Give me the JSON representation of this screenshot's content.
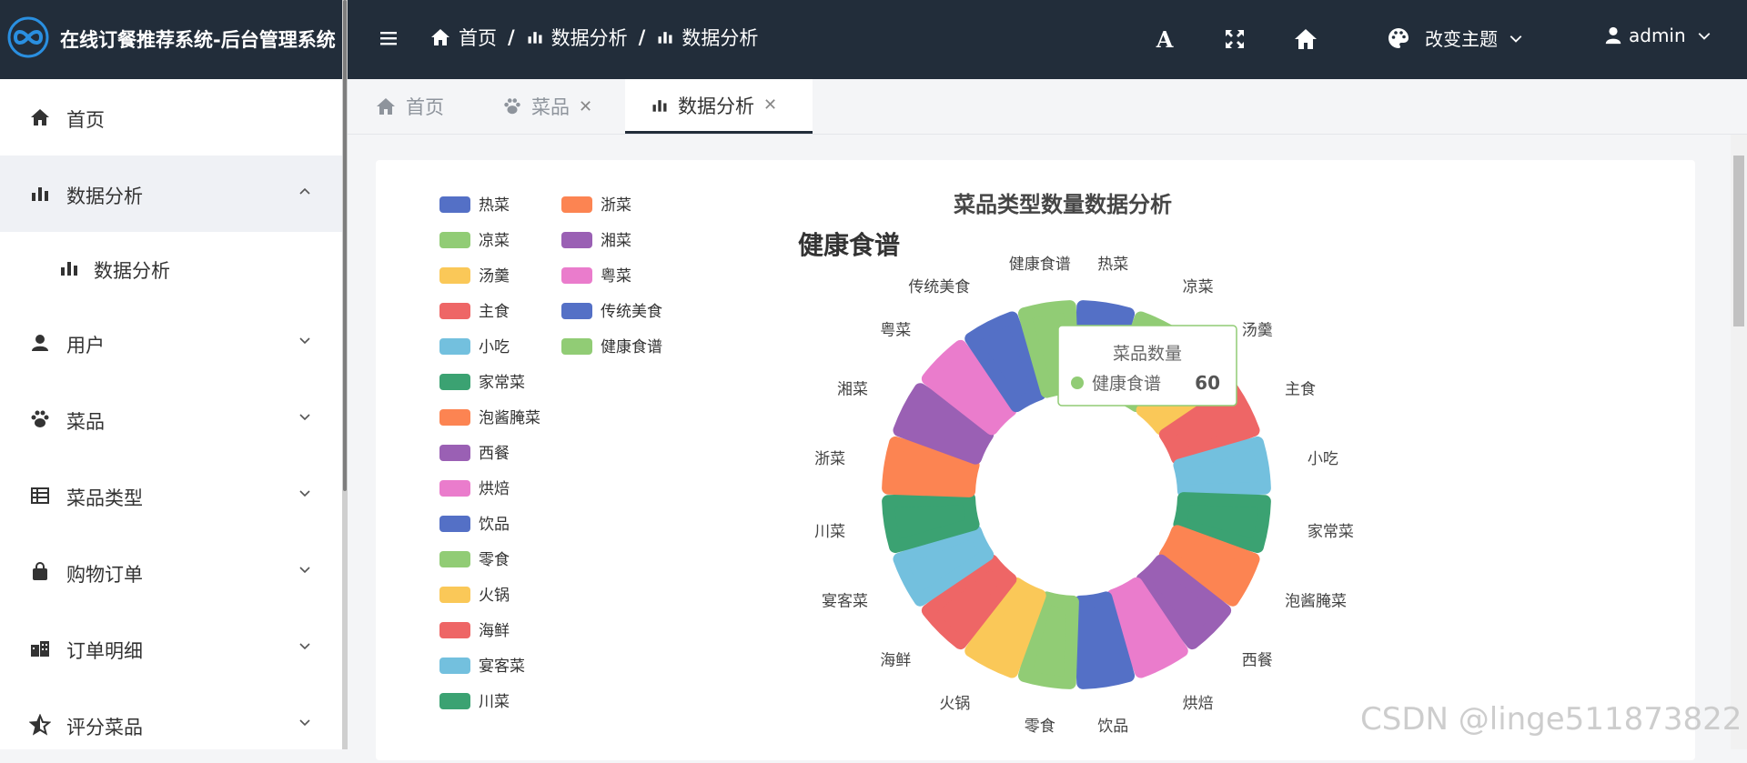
{
  "app": {
    "title": "在线订餐推荐系统-后台管理系统"
  },
  "sidebar": {
    "items": [
      {
        "label": "首页",
        "icon": "home-icon"
      },
      {
        "label": "数据分析",
        "icon": "bar-chart-icon",
        "open": true,
        "children": [
          {
            "label": "数据分析",
            "icon": "bar-chart-icon"
          }
        ]
      },
      {
        "label": "用户",
        "icon": "user-icon"
      },
      {
        "label": "菜品",
        "icon": "paw-icon"
      },
      {
        "label": "菜品类型",
        "icon": "table-icon"
      },
      {
        "label": "购物订单",
        "icon": "shopping-bag-icon"
      },
      {
        "label": "订单明细",
        "icon": "building-icon"
      },
      {
        "label": "评分菜品",
        "icon": "star-icon"
      }
    ]
  },
  "header": {
    "breadcrumb": [
      {
        "label": "首页",
        "icon": "home-icon"
      },
      {
        "label": "数据分析",
        "icon": "bar-chart-icon"
      },
      {
        "label": "数据分析",
        "icon": "bar-chart-icon"
      }
    ],
    "buttons": [
      "font-icon",
      "fullscreen-icon",
      "home-icon"
    ],
    "theme_label": "改变主题",
    "user_label": "admin"
  },
  "tabs": [
    {
      "label": "首页",
      "icon": "home-icon",
      "closable": false,
      "active": false
    },
    {
      "label": "菜品",
      "icon": "paw-icon",
      "closable": true,
      "active": false
    },
    {
      "label": "数据分析",
      "icon": "bar-chart-icon",
      "closable": true,
      "active": true
    }
  ],
  "chart_data": {
    "type": "pie",
    "variant": "rose-donut",
    "title": "菜品类型数量数据分析",
    "categories": [
      "热菜",
      "凉菜",
      "汤羹",
      "主食",
      "小吃",
      "家常菜",
      "泡酱腌菜",
      "西餐",
      "烘焙",
      "饮品",
      "零食",
      "火锅",
      "海鲜",
      "宴客菜",
      "川菜",
      "浙菜",
      "湘菜",
      "粤菜",
      "传统美食",
      "健康食谱"
    ],
    "values": [
      60,
      60,
      60,
      60,
      60,
      60,
      60,
      60,
      60,
      60,
      60,
      60,
      60,
      60,
      60,
      60,
      60,
      60,
      60,
      60
    ],
    "colors": [
      "#5470c6",
      "#91cc75",
      "#fac858",
      "#ee6666",
      "#73c0de",
      "#3ba272",
      "#fc8452",
      "#9a60b4",
      "#ea7ccc",
      "#5470c6",
      "#91cc75",
      "#fac858",
      "#ee6666",
      "#73c0de",
      "#3ba272",
      "#fc8452",
      "#9a60b4",
      "#ea7ccc",
      "#5470c6",
      "#91cc75"
    ],
    "legend_position": "top-left",
    "emphasis_label": "健康食谱",
    "tooltip": {
      "title": "菜品数量",
      "name": "健康食谱",
      "value": "60"
    }
  },
  "watermark": "CSDN @linge511873822"
}
